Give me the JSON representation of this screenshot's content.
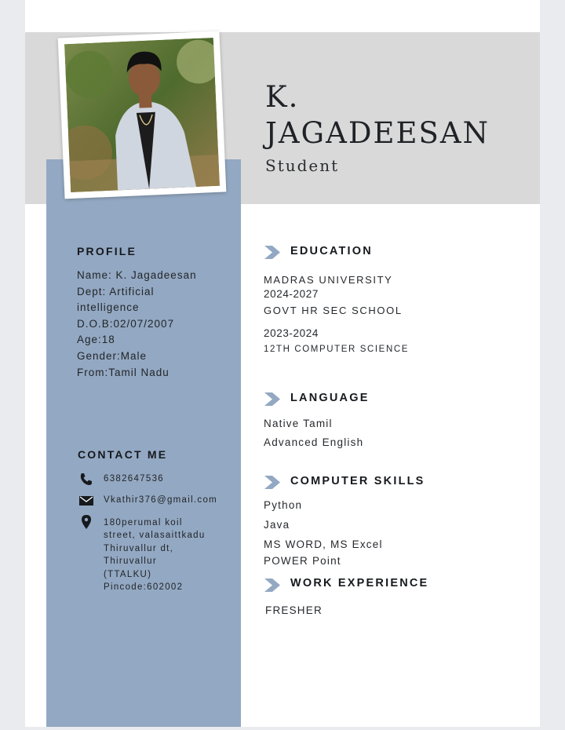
{
  "header": {
    "name_line1": "K.",
    "name_line2": "JAGADEESAN",
    "role": "Student"
  },
  "profile": {
    "heading": "PROFILE",
    "lines": [
      "Name: K. Jagadeesan",
      "Dept: Artificial",
      "intelligence",
      "D.O.B:02/07/2007",
      "Age:18",
      "Gender:Male",
      "From:Tamil Nadu"
    ]
  },
  "contact": {
    "heading": "CONTACT ME",
    "phone": "6382647536",
    "email": "Vkathir376@gmail.com",
    "address_lines": [
      "180perumal koil",
      "street, valasaittkadu",
      "Thiruvallur dt,",
      "Thiruvallur",
      "(TTALKU)",
      "Pincode:602002"
    ],
    "icons": [
      "phone-icon",
      "envelope-icon",
      "map-pin-icon"
    ]
  },
  "education": {
    "heading": "EDUCATION",
    "lines": [
      "MADRAS UNIVERSITY",
      "2024-2027",
      "GOVT HR SEC SCHOOL",
      "2023-2024",
      "12TH COMPUTER SCIENCE"
    ]
  },
  "language": {
    "heading": "LANGUAGE",
    "lines": [
      "Native Tamil",
      "Advanced English"
    ]
  },
  "skills": {
    "heading": "COMPUTER SKILLS",
    "lines": [
      "Python",
      "Java",
      "MS WORD, MS Excel",
      "POWER Point"
    ]
  },
  "experience": {
    "heading": "WORK EXPERIENCE",
    "lines": [
      "FRESHER"
    ]
  },
  "colors": {
    "sidebar": "#93a8c2",
    "header_band": "#d9d9d9",
    "chevron": "#93a8c2"
  }
}
